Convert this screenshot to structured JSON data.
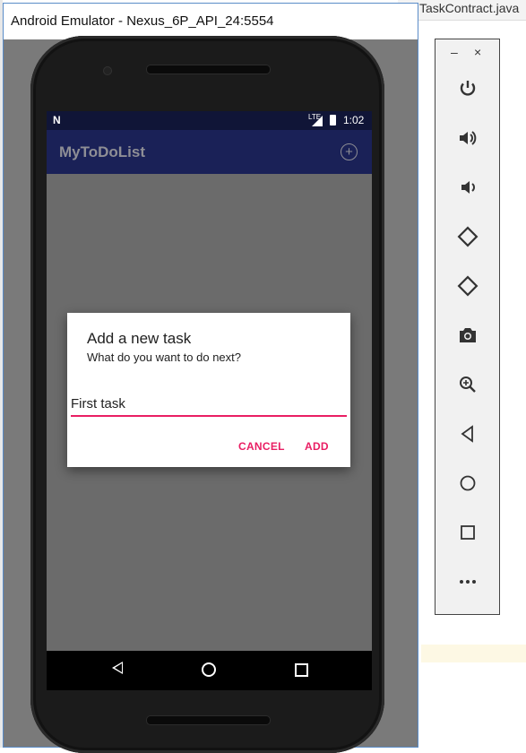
{
  "ide": {
    "tab_label": "TaskContract.java"
  },
  "emulator": {
    "window_title": "Android Emulator - Nexus_6P_API_24:5554"
  },
  "status_bar": {
    "network": "LTE",
    "time": "1:02"
  },
  "app": {
    "title": "MyToDoList"
  },
  "dialog": {
    "title": "Add a new task",
    "message": "What do you want to do next?",
    "input_value": "First task",
    "cancel_label": "CANCEL",
    "add_label": "ADD",
    "accent_color": "#e91e63"
  },
  "toolbar": {
    "minimize_label": "–",
    "close_label": "×",
    "icons": [
      "power-icon",
      "volume-up-icon",
      "volume-down-icon",
      "rotate-left-icon",
      "rotate-right-icon",
      "camera-icon",
      "zoom-icon",
      "back-icon",
      "home-icon",
      "overview-icon",
      "more-icon"
    ]
  },
  "colors": {
    "status_bar": "#101537",
    "app_bar": "#1a2157",
    "accent": "#e91e63"
  }
}
